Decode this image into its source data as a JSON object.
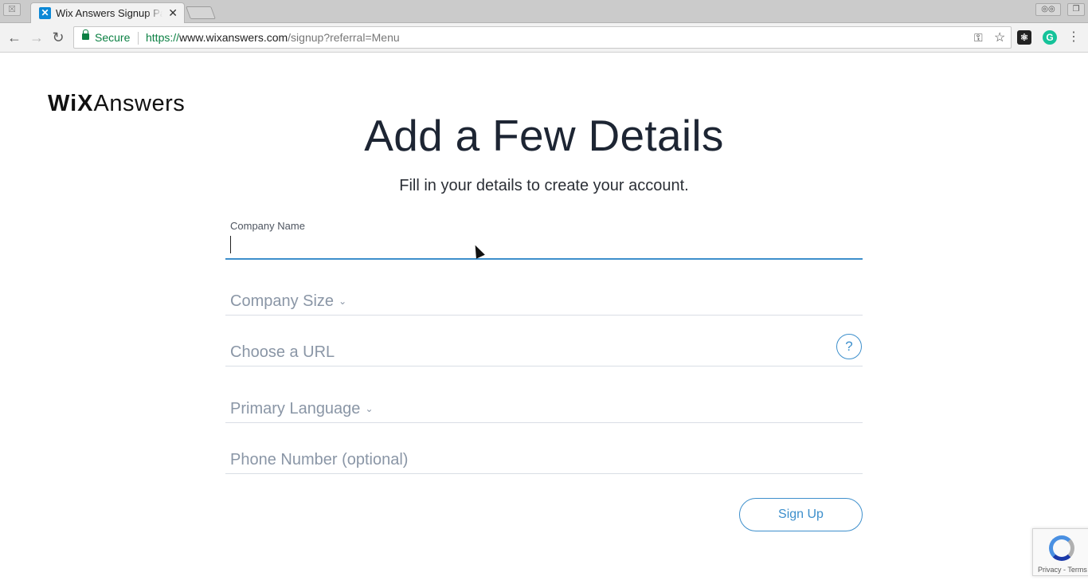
{
  "browser": {
    "tab": {
      "title": "Wix Answers Signup Page",
      "favicon_icon": "wix-answers-favicon"
    },
    "address": {
      "secure_label": "Secure",
      "url_scheme": "https://",
      "url_host": "www.wixanswers.com",
      "url_path": "/signup?referral=Menu"
    }
  },
  "header": {
    "logo_wix": "WiX",
    "logo_answers": "Answers"
  },
  "form": {
    "title": "Add a Few Details",
    "subtitle": "Fill in your details to create your account.",
    "company_name": {
      "label": "Company Name",
      "value": ""
    },
    "company_size": {
      "placeholder": "Company Size",
      "icon": "chevron-down-icon"
    },
    "url": {
      "placeholder": "Choose a URL",
      "help_icon": "?"
    },
    "primary_language": {
      "placeholder": "Primary Language",
      "icon": "chevron-down-icon"
    },
    "phone": {
      "placeholder": "Phone Number (optional)"
    },
    "submit_label": "Sign Up"
  },
  "recaptcha": {
    "text": "Privacy - Terms"
  },
  "colors": {
    "accent": "#3d8fcc",
    "heading": "#1d2533",
    "placeholder": "#8a96a6",
    "secure_green": "#0b8043"
  }
}
